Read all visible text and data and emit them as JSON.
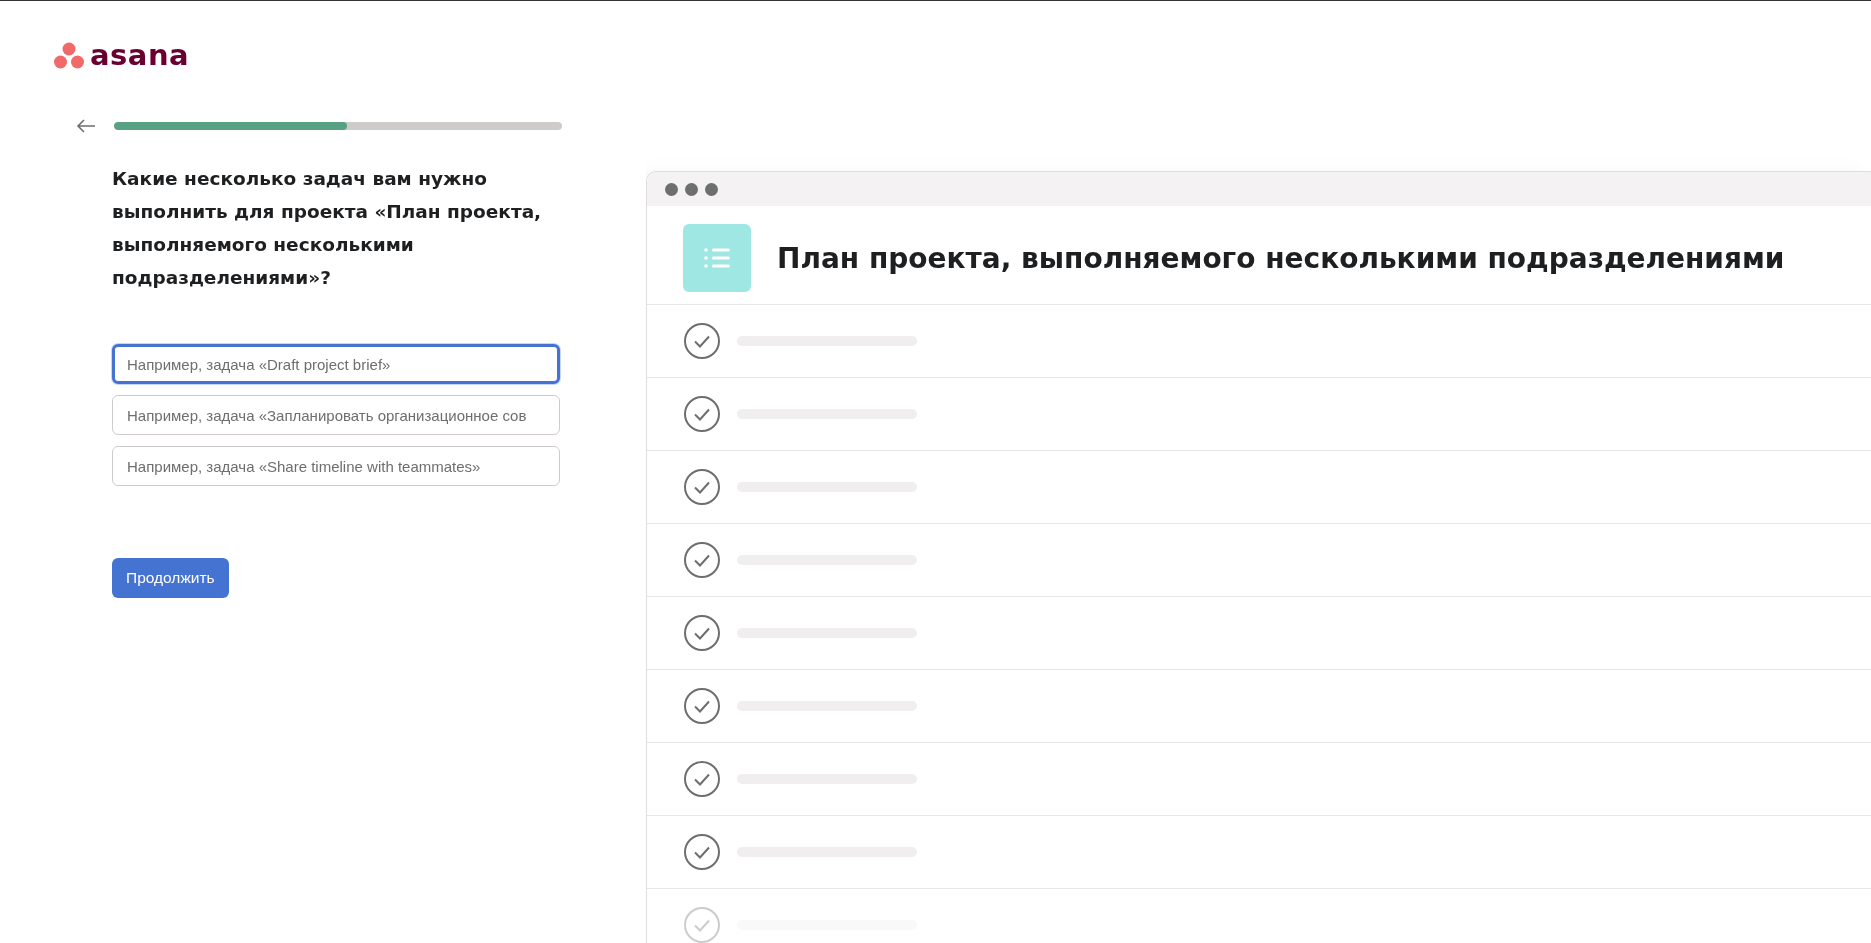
{
  "logo": {
    "text": "asana"
  },
  "progress": {
    "level": 0.52
  },
  "question": "Какие несколько задач вам нужно выполнить для проекта «План проекта, выполняемого несколькими подразделениями»?",
  "task_inputs": [
    {
      "placeholder": "Например, задача «Draft project brief»",
      "focused": true
    },
    {
      "placeholder": "Например, задача «Запланировать организационное сов",
      "focused": false
    },
    {
      "placeholder": "Например, задача «Share timeline with teammates»",
      "focused": false
    }
  ],
  "continue_button": "Продолжить",
  "preview": {
    "title": "План проекта, выполняемого несколькими подразделениями",
    "tasks": [
      {
        "faded": false
      },
      {
        "faded": false
      },
      {
        "faded": false
      },
      {
        "faded": false
      },
      {
        "faded": false
      },
      {
        "faded": false
      },
      {
        "faded": false
      },
      {
        "faded": false
      },
      {
        "faded": true
      }
    ]
  }
}
